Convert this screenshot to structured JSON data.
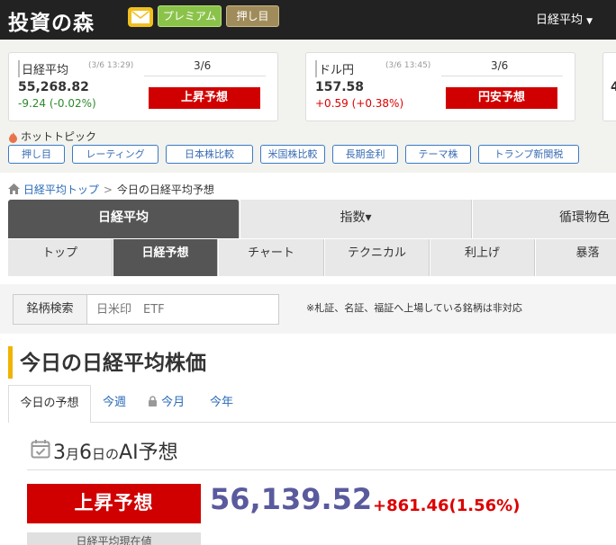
{
  "header": {
    "logo": "投資の森",
    "mail_icon": "mail-icon",
    "premium": "プレミアム",
    "oshime": "押し目",
    "menu_nikkei": "日経平均"
  },
  "quotes": [
    {
      "name": "日経平均",
      "time": "(3/6 13:29)",
      "date": "3/6",
      "price": "55,268.82",
      "change": "-9.24 (-0.02%)",
      "prediction": "上昇予想"
    },
    {
      "name": "ドル円",
      "time": "(3/6 13:45)",
      "date": "3/6",
      "price": "157.58",
      "change": "+0.59 (+0.38%)",
      "prediction": "円安予想"
    },
    {
      "price_partial": "4"
    }
  ],
  "hot_topics": {
    "label": "ホットトピック",
    "tags": [
      "押し目",
      "レーティング",
      "日本株比較",
      "米国株比較",
      "長期金利",
      "テーマ株",
      "トランプ新関税"
    ]
  },
  "breadcrumb": {
    "home": "日経平均トップ",
    "separator": ">",
    "current": "今日の日経平均予想"
  },
  "main_tabs": [
    "日経平均",
    "指数▾",
    "循環物色"
  ],
  "sub_tabs": [
    "トップ",
    "日経予想",
    "チャート",
    "テクニカル",
    "利上げ",
    "暴落"
  ],
  "search": {
    "label": "銘柄検索",
    "placeholder": "日米印　ETF",
    "note": "※札証、名証、福証へ上場している銘柄は非対応"
  },
  "page_title": "今日の日経平均株価",
  "period_tabs": [
    "今日の予想",
    "今週",
    "今月",
    "今年"
  ],
  "ai": {
    "date_month": "3",
    "month_unit": "月",
    "date_day": "6",
    "day_unit": "日",
    "particle": "の",
    "title": "AI予想",
    "prediction": "上昇予想",
    "value": "56,139.52",
    "change": "+861.46(1.56%)",
    "bottom_button": "日経平均現在値"
  },
  "colors": {
    "accent_red": "#d10000",
    "header_bg": "#222222",
    "premium_green": "#8bc34a",
    "link_blue": "#2a6bb8",
    "title_bar": "#f0b400"
  }
}
